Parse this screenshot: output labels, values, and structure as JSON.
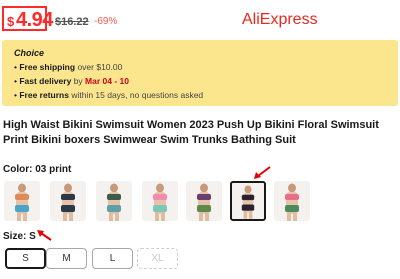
{
  "price": {
    "currency": "$",
    "amount": "4.94",
    "original": "$16.22",
    "discount": "-69%"
  },
  "brand": "AliExpress",
  "choice": {
    "title": "Choice",
    "lines": [
      {
        "bold": "Free shipping",
        "rest": " over $10.00"
      },
      {
        "bold": "Fast delivery",
        "rest": " by ",
        "highlight": "Mar 04 - 10"
      },
      {
        "bold": "Free returns",
        "rest": "  within 15 days, no questions asked"
      }
    ]
  },
  "product_title": "High Waist Bikini Swimsuit Women 2023 Push Up Bikini Floral Swimsuit Print Bikini boxers Swimwear Swim Trunks Bathing Suit",
  "color": {
    "label": "Color: 03 print",
    "options": [
      {
        "name": "variant-1",
        "top": "#e08a5a",
        "bottom": "#4aa3c8"
      },
      {
        "name": "variant-2",
        "top": "#2b3a4a",
        "bottom": "#2b3a4a"
      },
      {
        "name": "variant-3",
        "top": "#3d5a4a",
        "bottom": "#5fa0a8"
      },
      {
        "name": "variant-4",
        "top": "#f08ab0",
        "bottom": "#7cc8b8"
      },
      {
        "name": "variant-5",
        "top": "#6a3f73",
        "bottom": "#5d8a4a"
      },
      {
        "name": "variant-6",
        "top": "#2a2230",
        "bottom": "#2a2230"
      },
      {
        "name": "variant-7",
        "top": "#e86d8a",
        "bottom": "#4d8a5a"
      }
    ],
    "selected_index": 5
  },
  "size": {
    "label": "Size: S",
    "options": [
      "S",
      "M",
      "L",
      "XL"
    ],
    "selected": "S",
    "disabled": [
      "XL"
    ]
  },
  "colors": {
    "price_red": "#ff2b2b",
    "brand_red": "#e9281e",
    "choice_bg": "#fbe68d",
    "arrow_red": "#e60000"
  }
}
